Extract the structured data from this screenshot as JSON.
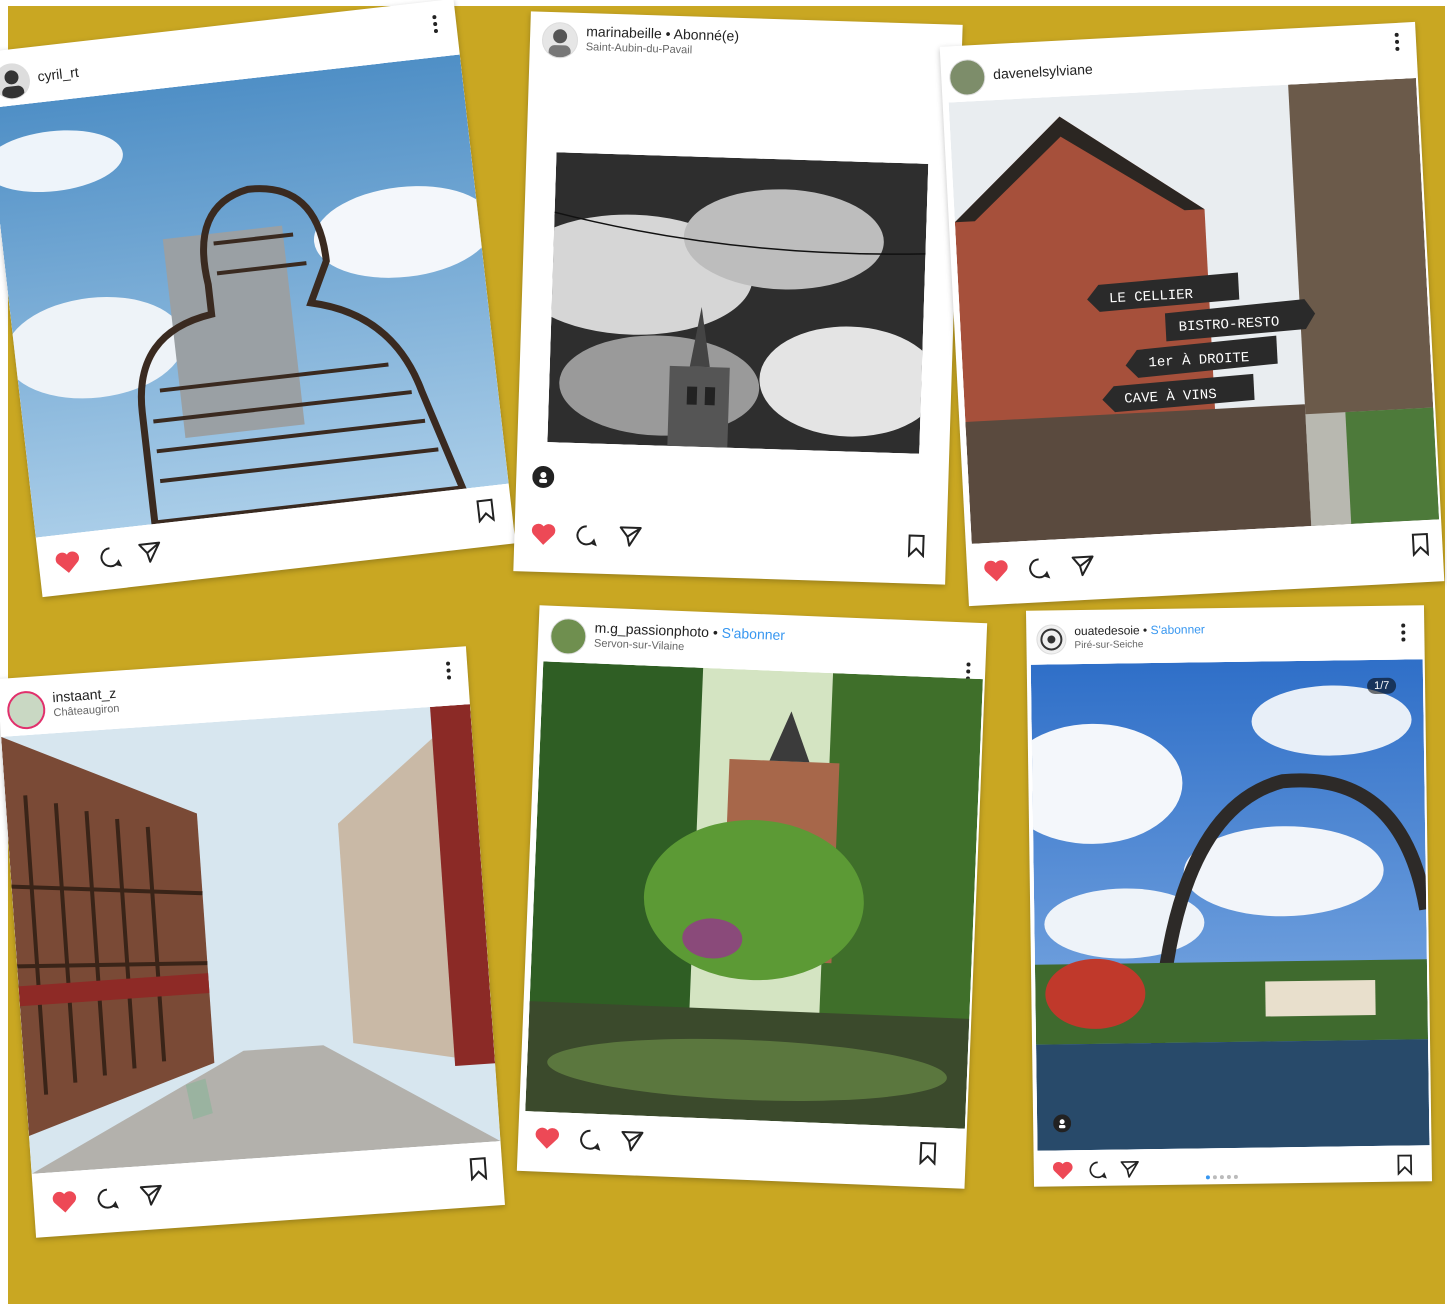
{
  "colors": {
    "board_background": "#c9a722",
    "card_background": "#ffffff",
    "like_red": "#ed4956",
    "follow_blue": "#3897f0",
    "text": "#222222"
  },
  "posts": [
    {
      "username": "cyril_rt",
      "status": "",
      "location": "",
      "photo_subject": "sculpture",
      "liked": true,
      "icons": [
        "heart-icon",
        "comment-icon",
        "share-icon",
        "bookmark-icon",
        "more-icon"
      ]
    },
    {
      "username": "marinabeille",
      "separator": " • ",
      "status": "Abonné(e)",
      "location": "Saint-Aubin-du-Pavail",
      "photo_subject": "church",
      "liked": true,
      "icons": [
        "heart-icon",
        "comment-icon",
        "share-icon",
        "bookmark-icon",
        "more-icon",
        "tag-icon"
      ]
    },
    {
      "username": "davenelsylviane",
      "status": "",
      "location": "",
      "photo_subject": "cellier",
      "liked": true,
      "signs": [
        "LE CELLIER",
        "BISTRO-RESTO",
        "1er À DROITE",
        "CAVE À VINS"
      ],
      "icons": [
        "heart-icon",
        "comment-icon",
        "share-icon",
        "bookmark-icon",
        "more-icon"
      ]
    },
    {
      "username": "instaant_z",
      "status": "",
      "location": "Châteaugiron",
      "photo_subject": "street",
      "liked": true,
      "icons": [
        "heart-icon",
        "comment-icon",
        "share-icon",
        "bookmark-icon",
        "more-icon"
      ]
    },
    {
      "username": "m.g_passionphoto",
      "separator": " • ",
      "status": "S'abonner",
      "location": "Servon-sur-Vilaine",
      "photo_subject": "castle",
      "liked": true,
      "icons": [
        "heart-icon",
        "comment-icon",
        "share-icon",
        "bookmark-icon",
        "more-icon"
      ]
    },
    {
      "username": "ouatedesoie",
      "separator": " • ",
      "status": "S'abonner",
      "location": "Piré-sur-Seiche",
      "photo_subject": "arch",
      "liked": true,
      "carousel_counter": "1/7",
      "carousel_total": 5,
      "carousel_active": 0,
      "icons": [
        "heart-icon",
        "comment-icon",
        "share-icon",
        "bookmark-icon",
        "more-icon",
        "tag-icon"
      ]
    }
  ]
}
